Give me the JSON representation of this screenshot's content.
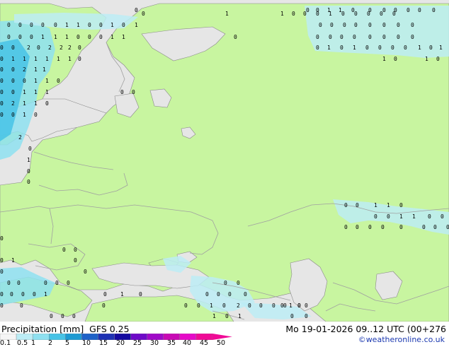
{
  "map": {
    "colors": {
      "land": "#c8f5a0",
      "water": "#e6e6e6",
      "border": "#a0a0a0",
      "coast": "#8a8a8a",
      "precip_light": "#bcecf5",
      "precip_mid": "#8ee0f0",
      "precip_dark": "#47c3e6"
    },
    "cell_labels": {
      "r17": [
        "0",
        "0",
        "0",
        "1",
        "1",
        "0",
        "0",
        "0",
        "0",
        "0",
        "0",
        "0"
      ],
      "r22": [
        "0",
        "1",
        "1",
        "0",
        "0",
        "0",
        "1",
        "0",
        "0",
        "0",
        "0",
        "0"
      ],
      "r38": [
        "0",
        "0",
        "0",
        "0",
        "0",
        "1",
        "1",
        "0",
        "0",
        "1",
        "0",
        "1",
        "0",
        "0",
        "0",
        "0",
        "0",
        "0",
        "0",
        "0"
      ],
      "r55": [
        "0",
        "0",
        "0",
        "1",
        "1",
        "1",
        "0",
        "0",
        "0",
        "1",
        "1",
        "0",
        "0",
        "0",
        "0",
        "0",
        "0",
        "0",
        "0",
        "0"
      ],
      "r70": [
        "0",
        "0",
        "2",
        "0",
        "2",
        "2",
        "2",
        "0",
        "0",
        "1",
        "0",
        "1",
        "0",
        "0",
        "0",
        "0",
        "1",
        "0",
        "1",
        "0"
      ],
      "r86": [
        "0",
        "1",
        "1",
        "1",
        "1",
        "1",
        "1",
        "0",
        "1",
        "0",
        "1",
        "0"
      ],
      "r101": [
        "0",
        "0",
        "2",
        "1",
        "1"
      ],
      "r117": [
        "0",
        "0",
        "0",
        "1",
        "1",
        "0"
      ],
      "r133": [
        "0",
        "0",
        "1",
        "1",
        "1",
        "0",
        "0"
      ],
      "r149": [
        "0",
        "2",
        "1",
        "1",
        "0"
      ],
      "r165": [
        "0",
        "0",
        "1",
        "0"
      ],
      "r197": [
        "2"
      ],
      "r213": [
        "0"
      ],
      "r229": [
        "1"
      ],
      "r245": [
        "0"
      ],
      "r260": [
        "0"
      ],
      "r293": [
        "0",
        "0",
        "1",
        "1",
        "0"
      ],
      "r309": [
        "0",
        "0",
        "1",
        "1",
        "0",
        "0"
      ],
      "r324": [
        "0",
        "0",
        "0",
        "0",
        "0",
        "0",
        "0",
        "0"
      ],
      "r340": [
        "0"
      ],
      "r356": [
        "0",
        "0"
      ],
      "r371": [
        "0",
        "1",
        "0"
      ],
      "r387": [
        "0",
        "0"
      ],
      "r403": [
        "0",
        "0",
        "0",
        "0",
        "0",
        "0",
        "0"
      ],
      "r419": [
        "0",
        "0",
        "0",
        "0",
        "1",
        "0",
        "1",
        "0",
        "0",
        "0",
        "0",
        "0"
      ],
      "r435": [
        "0",
        "0",
        "0",
        "0",
        "0",
        "1",
        "0",
        "2",
        "0",
        "0",
        "0",
        "0",
        "0",
        "0",
        "1",
        "0",
        "0"
      ],
      "r450": [
        "0",
        "0",
        "0",
        "1",
        "0",
        "1",
        "0",
        "0"
      ]
    }
  },
  "legend": {
    "title": "Precipitation [mm]  GFS 0.25",
    "tick_labels": [
      "0.1",
      "0.5",
      "1",
      "2",
      "5",
      "10",
      "15",
      "20",
      "25",
      "30",
      "35",
      "40",
      "45",
      "50"
    ],
    "colors": [
      "#f5f5f5",
      "#bcecf5",
      "#8ee0f0",
      "#47c3e6",
      "#1e9ad2",
      "#1e62c8",
      "#1e32b4",
      "#140aa0",
      "#6e0ac8",
      "#a00ac8",
      "#c80ab4",
      "#e60ac8",
      "#f00a96"
    ]
  },
  "valid_time": "Mo 19-01-2026 09..12 UTC (00+276",
  "copyright": "©weatheronline.co.uk"
}
